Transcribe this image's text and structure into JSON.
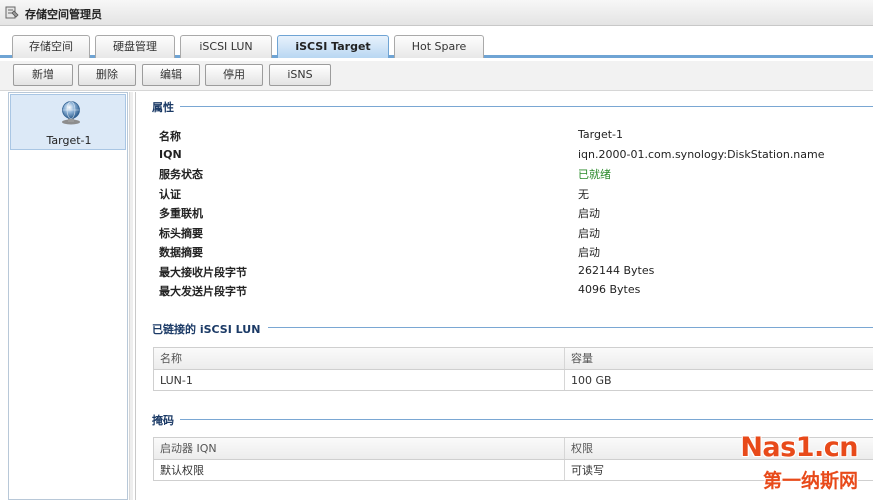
{
  "window": {
    "title": "存储空间管理员"
  },
  "tabs": [
    {
      "label": "存储空间"
    },
    {
      "label": "硬盘管理"
    },
    {
      "label": "iSCSI LUN"
    },
    {
      "label": "iSCSI Target",
      "active": true
    },
    {
      "label": "Hot Spare"
    }
  ],
  "toolbar": {
    "create": "新增",
    "delete": "删除",
    "edit": "编辑",
    "disable": "停用",
    "isns": "iSNS"
  },
  "targets": [
    {
      "name": "Target-1",
      "icon": "globe-target-icon"
    }
  ],
  "properties": {
    "section_title": "属性",
    "rows": [
      {
        "label": "名称",
        "value": "Target-1"
      },
      {
        "label": "IQN",
        "value": "iqn.2000-01.com.synology:DiskStation.name"
      },
      {
        "label": "服务状态",
        "value": "已就绪",
        "status_color": "#2a8a2a"
      },
      {
        "label": "认证",
        "value": "无"
      },
      {
        "label": "多重联机",
        "value": "启动"
      },
      {
        "label": "标头摘要",
        "value": "启动"
      },
      {
        "label": "数据摘要",
        "value": "启动"
      },
      {
        "label": "最大接收片段字节",
        "value": "262144 Bytes"
      },
      {
        "label": "最大发送片段字节",
        "value": "4096 Bytes"
      }
    ]
  },
  "linked_luns": {
    "section_title": "已链接的 iSCSI LUN",
    "columns": [
      "名称",
      "容量"
    ],
    "rows": [
      [
        "LUN-1",
        "100 GB"
      ]
    ]
  },
  "masking": {
    "section_title": "掩码",
    "columns": [
      "启动器 IQN",
      "权限"
    ],
    "rows": [
      [
        "默认权限",
        "可读写"
      ]
    ]
  },
  "watermark": {
    "line1": "Nas1.cn",
    "line2": "第一纳斯网"
  },
  "colors": {
    "accent": "#6fa4d4",
    "section_title": "#1b3a66",
    "status_ready": "#2a8a2a",
    "watermark": "#e84a1a"
  }
}
